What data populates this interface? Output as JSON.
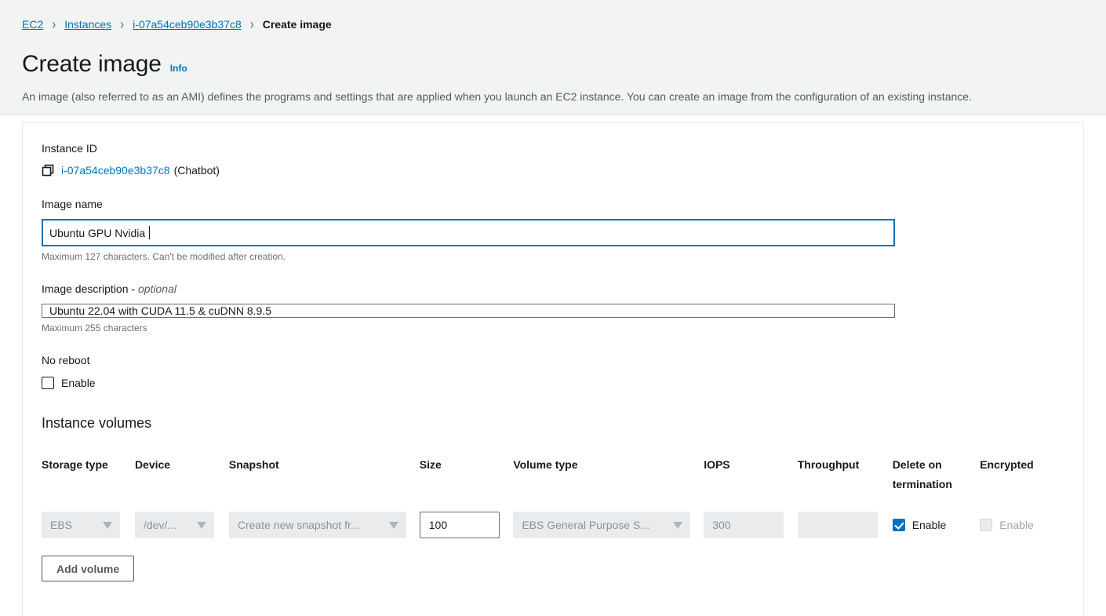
{
  "breadcrumb": {
    "items": [
      {
        "label": "EC2",
        "type": "link"
      },
      {
        "label": "Instances",
        "type": "link"
      },
      {
        "label": "i-07a54ceb90e3b37c8",
        "type": "link"
      },
      {
        "label": "Create image",
        "type": "current"
      }
    ],
    "separator": "›"
  },
  "header": {
    "title": "Create image",
    "info_label": "Info",
    "description": "An image (also referred to as an AMI) defines the programs and settings that are applied when you launch an EC2 instance. You can create an image from the configuration of an existing instance."
  },
  "form": {
    "instance_id": {
      "label": "Instance ID",
      "copy_icon": "copy-icon",
      "value": "i-07a54ceb90e3b37c8",
      "name_suffix": "(Chatbot)"
    },
    "image_name": {
      "label": "Image name",
      "value": "Ubuntu GPU Nvidia ",
      "placeholder": "",
      "hint": "Maximum 127 characters. Can't be modified after creation.",
      "focused": true
    },
    "image_description": {
      "label": "Image description - ",
      "label_optional": "optional",
      "value": "Ubuntu 22.04 with CUDA 11.5 & cuDNN 8.9.5",
      "placeholder": "",
      "hint": "Maximum 255 characters"
    },
    "no_reboot": {
      "label": "No reboot",
      "checkbox_label": "Enable",
      "checked": false
    }
  },
  "volumes": {
    "heading": "Instance volumes",
    "columns": [
      "Storage type",
      "Device",
      "Snapshot",
      "Size",
      "Volume type",
      "IOPS",
      "Throughput",
      "Delete on termination",
      "Encrypted"
    ],
    "rows": [
      {
        "storage_type": "EBS",
        "device": "/dev/...",
        "snapshot": "Create new snapshot fr...",
        "size": "100",
        "volume_type": "EBS General Purpose S...",
        "iops": "300",
        "throughput": "",
        "delete_on_termination": {
          "label": "Enable",
          "checked": true,
          "disabled": false
        },
        "encrypted": {
          "label": "Enable",
          "checked": false,
          "disabled": true
        }
      }
    ],
    "add_volume_label": "Add volume"
  },
  "colors": {
    "link": "#0073bb",
    "accent": "#0073bb",
    "text": "#16191f",
    "muted": "#545b64",
    "disabled_bg": "#e9ebed",
    "page_bg": "#f2f3f3"
  }
}
